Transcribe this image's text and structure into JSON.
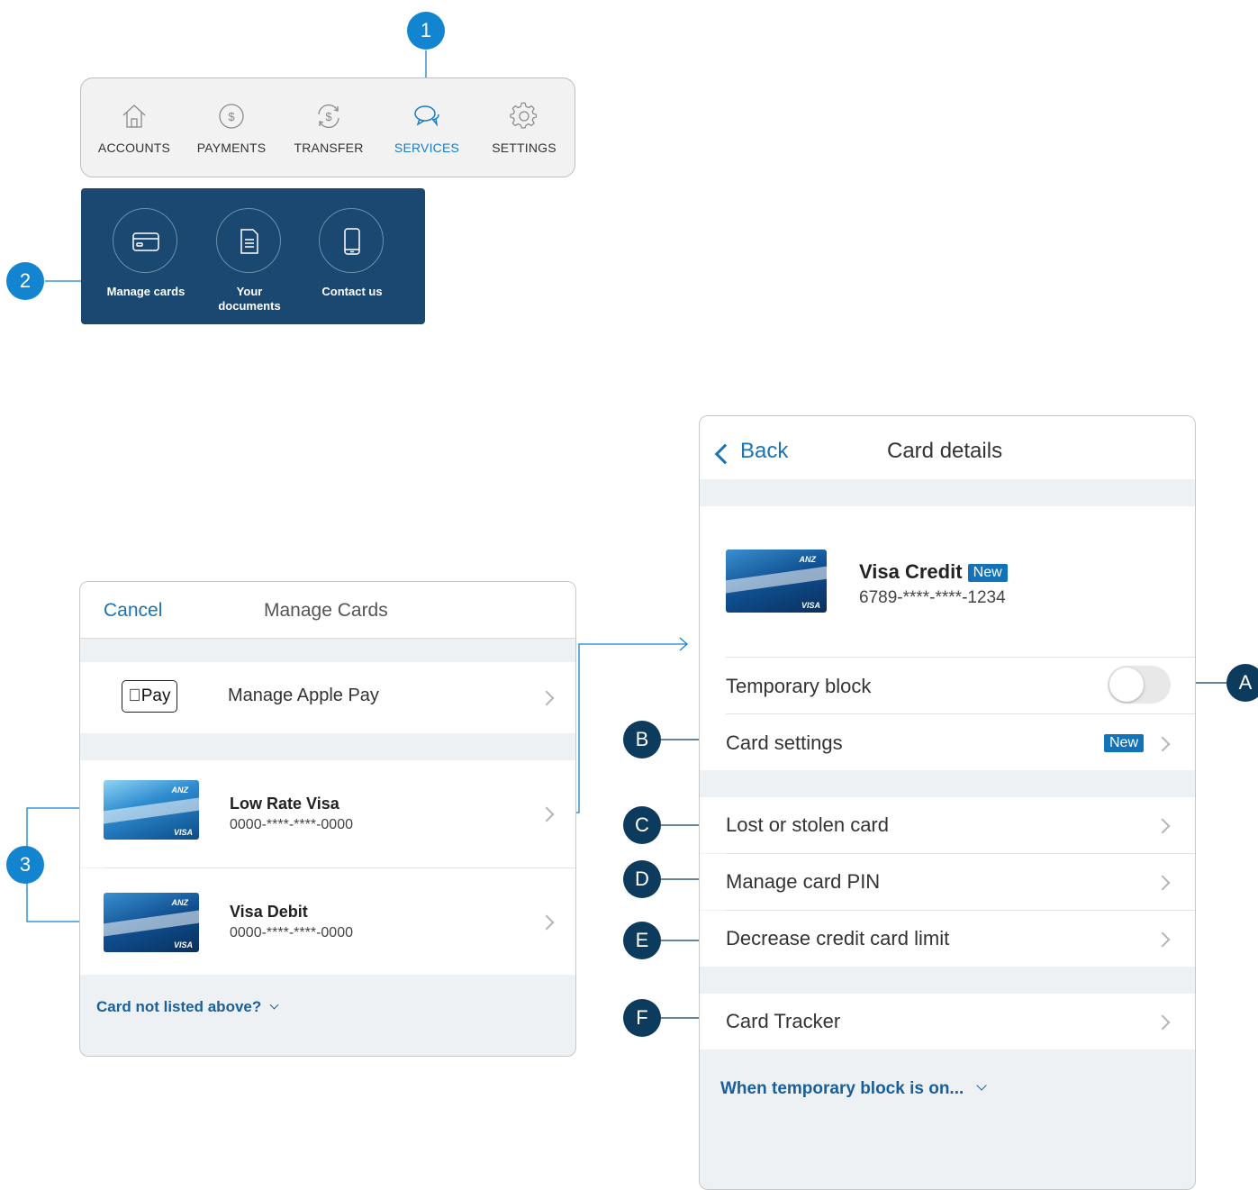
{
  "tabbar": {
    "tabs": [
      {
        "label": "ACCOUNTS",
        "icon": "home-icon"
      },
      {
        "label": "PAYMENTS",
        "icon": "dollar-circle-icon"
      },
      {
        "label": "TRANSFER",
        "icon": "transfer-dollar-icon"
      },
      {
        "label": "SERVICES",
        "icon": "chat-bubbles-icon"
      },
      {
        "label": "SETTINGS",
        "icon": "gear-icon"
      }
    ],
    "active_tab": "SERVICES",
    "active_color": "#1a7ec3"
  },
  "services": {
    "items": [
      {
        "label": "Manage cards",
        "icon": "credit-card-icon"
      },
      {
        "label": "Your\ndocuments",
        "icon": "document-icon"
      },
      {
        "label": "Contact us",
        "icon": "phone-icon"
      }
    ],
    "background": "#1b4870"
  },
  "callouts": {
    "one": "1",
    "two": "2",
    "three": "3",
    "a": "A",
    "b": "B",
    "c": "C",
    "d": "D",
    "e": "E",
    "f": "F"
  },
  "manage_cards": {
    "cancel": "Cancel",
    "title": "Manage Cards",
    "apple_pay_logo": "Pay",
    "apple_pay_label": "Manage Apple Pay",
    "cards": [
      {
        "name": "Low Rate Visa",
        "number": "0000-****-****-0000",
        "brand": "VISA",
        "bank": "ANZ"
      },
      {
        "name": "Visa Debit",
        "number": "0000-****-****-0000",
        "brand": "VISA",
        "bank": "ANZ"
      }
    ],
    "footer_link": "Card not listed above?"
  },
  "card_details": {
    "back": "Back",
    "title": "Card details",
    "card_name": "Visa Credit",
    "new_badge": "New",
    "card_number": "6789-****-****-1234",
    "card_brand": "VISA",
    "card_bank": "ANZ",
    "temporary_block": "Temporary block",
    "temporary_block_on": false,
    "card_settings": "Card settings",
    "card_settings_badge": "New",
    "lost_stolen": "Lost or stolen card",
    "manage_pin": "Manage card PIN",
    "decrease_limit": "Decrease credit card limit",
    "card_tracker": "Card Tracker",
    "footer_link": "When temporary block is on..."
  }
}
